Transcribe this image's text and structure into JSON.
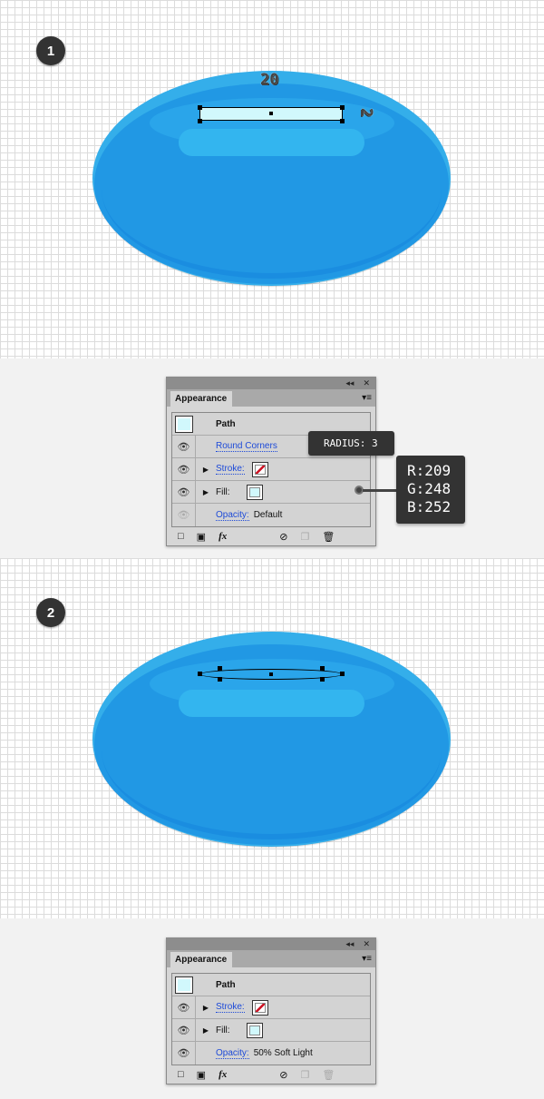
{
  "steps": [
    {
      "number": "1"
    },
    {
      "number": "2"
    }
  ],
  "dimensions": {
    "width": "20",
    "height": "2"
  },
  "panel1": {
    "tab": "Appearance",
    "title": "Path",
    "rows": [
      {
        "label": "Round Corners",
        "value": ""
      },
      {
        "label": "Stroke:"
      },
      {
        "label": "Fill:"
      },
      {
        "label": "Opacity:",
        "value": "Default"
      }
    ]
  },
  "panel2": {
    "tab": "Appearance",
    "title": "Path",
    "rows": [
      {
        "label": "Stroke:"
      },
      {
        "label": "Fill:"
      },
      {
        "label": "Opacity:",
        "value": "50% Soft Light"
      }
    ]
  },
  "tooltips": {
    "radius": "RADIUS: 3",
    "r": "R:209",
    "g": "G:248",
    "b": "B:252"
  },
  "colors": {
    "fill": "#d1f8fc",
    "pill": "#2198e4",
    "stroke": "#cc1122"
  },
  "footer_icons": [
    "new-stroke-icon",
    "new-fill-icon",
    "fx-icon",
    "clear-icon",
    "duplicate-icon",
    "trash-icon"
  ],
  "fx": "fx"
}
